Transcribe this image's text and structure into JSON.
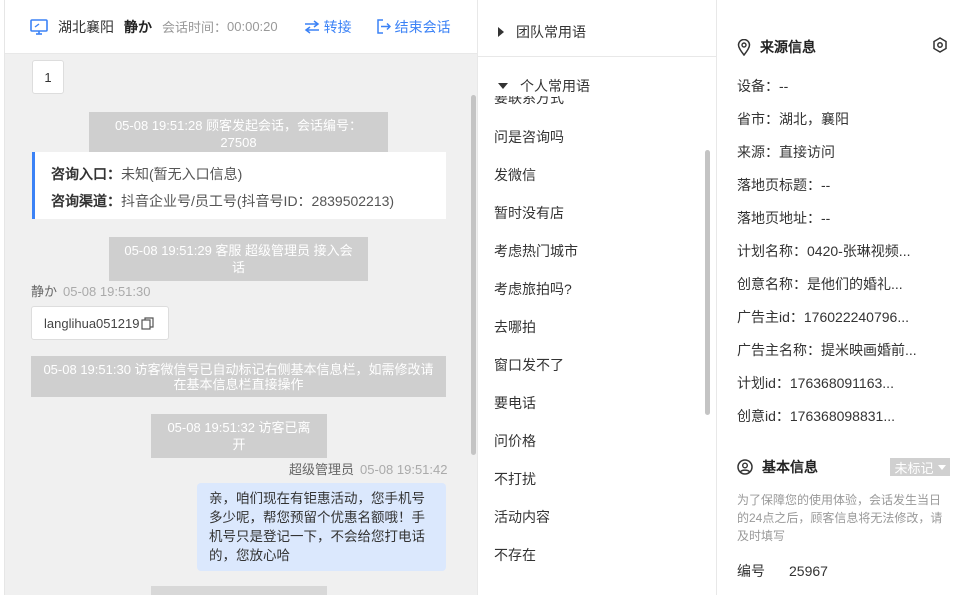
{
  "header": {
    "location": "湖北襄阳",
    "agent_name": "静か",
    "session_time_label": "会话时间：",
    "session_time": "00:00:20",
    "transfer_label": "转接",
    "end_label": "结束会话"
  },
  "chat": {
    "page_number": "1",
    "messages": {
      "start": "05-08 19:51:28 顾客发起会话，会话编号：27508",
      "entry_label": "咨询入口：",
      "entry_value": "未知(暂无入口信息)",
      "channel_label": "咨询渠道：",
      "channel_value": "抖音企业号/员工号(抖音号ID：2839502213)",
      "agent_join": "05-08 19:51:29 客服 超级管理员 接入会话",
      "visitor_name": "静か",
      "visitor_time": "05-08 19:51:30",
      "visitor_text": "langlihua051219",
      "wechat_notice": "05-08 19:51:30 访客微信号已自动标记右侧基本信息栏，如需修改请在基本信息栏直接操作",
      "visitor_left": "05-08 19:51:32 访客已离开",
      "agent_name": "超级管理员",
      "agent_time": "05-08 19:51:42",
      "agent_text": "亲，咱们现在有钜惠活动，您手机号多少呢，帮您预留个优惠名额哦！手机号只是登记一下，不会给您打电话的，您放心哈"
    }
  },
  "phrases": {
    "team_label": "团队常用语",
    "personal_label": "个人常用语",
    "partial_item": "要联系方式",
    "items": [
      "问是咨询吗",
      "发微信",
      "暂时没有店",
      "考虑热门城市",
      "考虑旅拍吗?",
      "去哪拍",
      "窗口发不了",
      "要电话",
      "问价格",
      "不打扰",
      "活动内容",
      "不存在"
    ]
  },
  "source": {
    "title": "来源信息",
    "rows": [
      "设备：--",
      "省市：湖北，襄阳",
      "来源：直接访问",
      "落地页标题：--",
      "落地页地址：--",
      "计划名称：0420-张琳视频...",
      "创意名称：是他们的婚礼...",
      "广告主id：176022240796...",
      "广告主名称：提米映画婚前...",
      "计划id：176368091163...",
      "创意id：176368098831..."
    ]
  },
  "basic": {
    "title": "基本信息",
    "tag_label": "未标记",
    "note": "为了保障您的使用体验，会话发生当日的24点之后，顾客信息将无法修改，请及时填写",
    "id_label": "编号",
    "id_value": "25967"
  },
  "colors": {
    "accent": "#3b82f6",
    "agent_bubble": "#dbe8fd",
    "system_msg": "#cfcfcf"
  }
}
